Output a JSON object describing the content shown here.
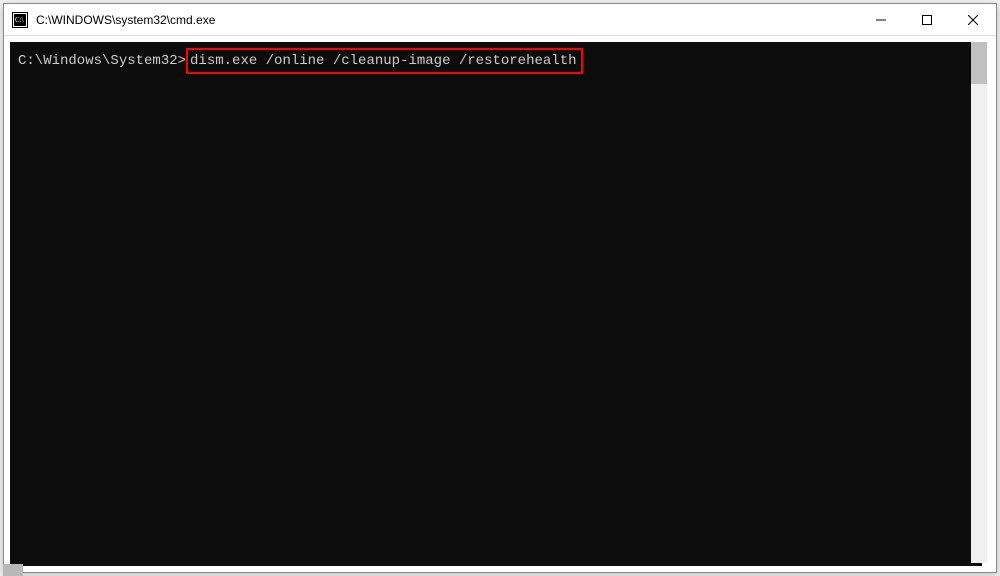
{
  "window": {
    "title": "C:\\WINDOWS\\system32\\cmd.exe"
  },
  "terminal": {
    "prompt": "C:\\Windows\\System32>",
    "command": "dism.exe /online /cleanup-image /restorehealth"
  }
}
